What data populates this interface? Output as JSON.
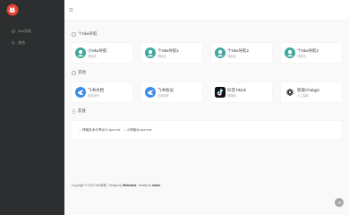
{
  "sidebar": {
    "logo_icon": "fox-logo-icon",
    "items": [
      {
        "label": "Nka导航",
        "icon": "compass-icon"
      },
      {
        "label": "其他",
        "icon": "tag-icon"
      }
    ]
  },
  "header": {
    "menu_icon": "menu-icon"
  },
  "sections": [
    {
      "title": "个Nka导航",
      "icon": "folder-icon",
      "cards": [
        {
          "title": "小Nka导航",
          "desc": "导航站",
          "icon": "robot-icon"
        },
        {
          "title": "个Nka导航1",
          "desc": "导航站",
          "icon": "robot-icon"
        },
        {
          "title": "个Nka导航2",
          "desc": "导航站",
          "icon": "robot-icon"
        },
        {
          "title": "个Nka导航3",
          "desc": "导航站",
          "icon": "robot-icon"
        }
      ]
    },
    {
      "title": "其他",
      "icon": "folder-icon",
      "cards": [
        {
          "title": "飞书文档",
          "desc": "在线协作",
          "icon": "feishu-bird-icon"
        },
        {
          "title": "飞书会议",
          "desc": "在线协作",
          "icon": "feishu-bird-icon"
        },
        {
          "title": "抖音Tiktok",
          "desc": "短视频",
          "icon": "tiktok-icon"
        },
        {
          "title": "智能Chatgpt",
          "desc": "人工智能",
          "icon": "openai-icon"
        }
      ]
    }
  ],
  "friend_links": {
    "title": "友链",
    "icon": "link-icon",
    "links": [
      "博客技术分享@11.lyon.me",
      "小博客@.lyon.me"
    ]
  },
  "footer": {
    "copyright": "Copyright © 2023 Nka导航",
    "design_prefix": "Design by",
    "design_name": "Webstack",
    "modify_prefix": "Modify by",
    "modify_name": "lowen"
  },
  "back_to_top_icon": "arrow-up-icon",
  "colors": {
    "page_bg": "#f9f9f9",
    "sidebar_bg": "#2c2e2f",
    "logo_red": "#e5432f",
    "site_teal": "#3fa79c",
    "feishu_blue": "#3c8de8",
    "tiktok_black": "#111111",
    "backtop_bg": "#a6a6a6"
  }
}
